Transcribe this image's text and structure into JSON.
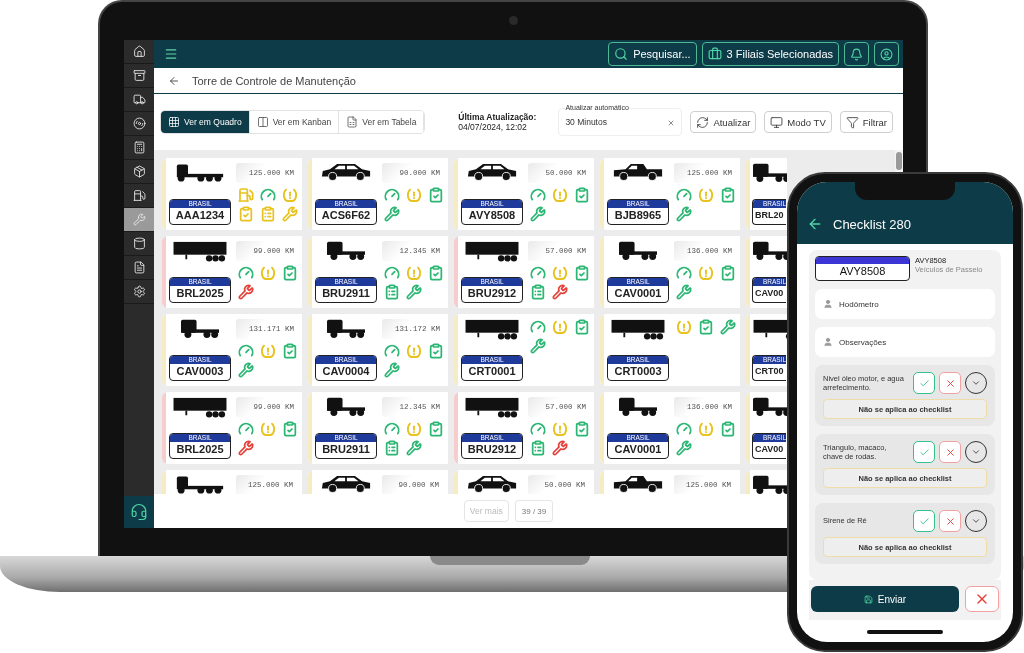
{
  "sidebar": {
    "items": [
      {
        "selected": false
      },
      {
        "selected": false
      },
      {
        "selected": false
      },
      {
        "selected": false
      },
      {
        "selected": false
      },
      {
        "selected": false
      },
      {
        "selected": false
      },
      {
        "selected": true
      },
      {
        "selected": false
      },
      {
        "selected": false
      },
      {
        "selected": false
      }
    ]
  },
  "topbar": {
    "search": "Pesquisar...",
    "branches": "3 Filiais Selecionadas"
  },
  "page": {
    "title": "Torre de Controle de Manutenção"
  },
  "view_tabs": [
    {
      "label": "Ver em Quadro",
      "selected": true
    },
    {
      "label": "Ver em Kanban",
      "selected": false
    },
    {
      "label": "Ver em Tabela",
      "selected": false
    }
  ],
  "last_update": {
    "label": "Última Atualização:",
    "value": "04/07/2024, 12:02"
  },
  "auto_refresh": {
    "label": "Atualizar automático",
    "value": "30 Minutos"
  },
  "buttons": [
    "Atualizar",
    "Modo TV",
    "Filtrar"
  ],
  "vehicles": [
    {
      "kind": "truck",
      "odometer": "125.000 KM",
      "plate_header": "BRASIL",
      "plate": "AAA1234",
      "color": "#f5ecc4",
      "statuses": [
        {
          "kind": "fuel",
          "color": "#e8c21e"
        },
        {
          "kind": "gauge",
          "color": "#2bb673"
        },
        {
          "kind": "tire",
          "color": "#e8c21e"
        },
        {
          "kind": "check",
          "color": "#e8c21e"
        },
        {
          "kind": "list",
          "color": "#e8c21e"
        },
        {
          "kind": "tools",
          "color": "#e8c21e"
        }
      ]
    },
    {
      "kind": "car",
      "odometer": "90.000 KM",
      "plate_header": "BRASIL",
      "plate": "ACS6F62",
      "color": "#f5ecc4",
      "statuses": [
        {
          "kind": "gauge",
          "color": "#2bb673"
        },
        {
          "kind": "tire",
          "color": "#e8c21e"
        },
        {
          "kind": "check",
          "color": "#2bb673"
        },
        {
          "kind": "tools",
          "color": "#2bb673"
        }
      ]
    },
    {
      "kind": "car",
      "odometer": "50.000 KM",
      "plate_header": "BRASIL",
      "plate": "AVY8508",
      "color": "#f5ecc4",
      "statuses": [
        {
          "kind": "gauge",
          "color": "#2bb673"
        },
        {
          "kind": "tire",
          "color": "#e8c21e"
        },
        {
          "kind": "check",
          "color": "#2bb673"
        },
        {
          "kind": "tools",
          "color": "#2bb673"
        }
      ]
    },
    {
      "kind": "pickup",
      "odometer": "125.000 KM",
      "plate_header": "BRASIL",
      "plate": "BJB8965",
      "color": "#f5ecc4",
      "statuses": [
        {
          "kind": "gauge",
          "color": "#2bb673"
        },
        {
          "kind": "tire",
          "color": "#e8c21e"
        },
        {
          "kind": "check",
          "color": "#2bb673"
        },
        {
          "kind": "tools",
          "color": "#2bb673"
        }
      ]
    },
    {
      "kind": "tractor",
      "plate_header": "BRASIL",
      "plate": "BRL20",
      "color": "#f5ecc4"
    },
    {
      "kind": "trailer",
      "odometer": "99.000 KM",
      "plate_header": "BRASIL",
      "plate": "BRL2025",
      "color": "#f6cccc",
      "statuses": [
        {
          "kind": "gauge",
          "color": "#2bb673"
        },
        {
          "kind": "tire",
          "color": "#e8c21e"
        },
        {
          "kind": "check",
          "color": "#2bb673"
        },
        {
          "kind": "tools",
          "color": "#e5413b"
        }
      ]
    },
    {
      "kind": "tractor",
      "odometer": "12.345 KM",
      "plate_header": "BRASIL",
      "plate": "BRU2911",
      "color": "#f5ecc4",
      "statuses": [
        {
          "kind": "gauge",
          "color": "#2bb673"
        },
        {
          "kind": "tire",
          "color": "#e8c21e"
        },
        {
          "kind": "check",
          "color": "#2bb673"
        },
        {
          "kind": "list",
          "color": "#2bb673"
        },
        {
          "kind": "tools",
          "color": "#2bb673"
        }
      ]
    },
    {
      "kind": "trailer",
      "odometer": "57.000 KM",
      "plate_header": "BRASIL",
      "plate": "BRU2912",
      "color": "#f6cccc",
      "statuses": [
        {
          "kind": "gauge",
          "color": "#2bb673"
        },
        {
          "kind": "tire",
          "color": "#e8c21e"
        },
        {
          "kind": "check",
          "color": "#2bb673"
        },
        {
          "kind": "list",
          "color": "#2bb673"
        },
        {
          "kind": "tools",
          "color": "#e5413b"
        }
      ]
    },
    {
      "kind": "tractor",
      "odometer": "136.000 KM",
      "plate_header": "BRASIL",
      "plate": "CAV0001",
      "color": "#f5ecc4",
      "statuses": [
        {
          "kind": "gauge",
          "color": "#2bb673"
        },
        {
          "kind": "tire",
          "color": "#e8c21e"
        },
        {
          "kind": "check",
          "color": "#2bb673"
        },
        {
          "kind": "tools",
          "color": "#2bb673"
        }
      ]
    },
    {
      "kind": "tractor",
      "plate_header": "BRASIL",
      "plate": "CAV00",
      "color": "#f5ecc4"
    },
    {
      "kind": "tractor",
      "odometer": "131.171 KM",
      "plate_header": "BRASIL",
      "plate": "CAV0003",
      "color": "#f5ecc4",
      "statuses": [
        {
          "kind": "gauge",
          "color": "#2bb673"
        },
        {
          "kind": "tire",
          "color": "#e8c21e"
        },
        {
          "kind": "check",
          "color": "#2bb673"
        },
        {
          "kind": "tools",
          "color": "#2bb673"
        }
      ]
    },
    {
      "kind": "tractor",
      "odometer": "131.172 KM",
      "plate_header": "BRASIL",
      "plate": "CAV0004",
      "color": "#f5ecc4",
      "statuses": [
        {
          "kind": "gauge",
          "color": "#2bb673"
        },
        {
          "kind": "tire",
          "color": "#e8c21e"
        },
        {
          "kind": "check",
          "color": "#2bb673"
        },
        {
          "kind": "tools",
          "color": "#2bb673"
        }
      ]
    },
    {
      "kind": "trailer",
      "plate_header": "BRASIL",
      "plate": "CRT0001",
      "color": "#f5ecc4",
      "statuses": [
        {
          "kind": "gauge",
          "color": "#2bb673"
        },
        {
          "kind": "tire",
          "color": "#e8c21e"
        },
        {
          "kind": "check",
          "color": "#2bb673"
        },
        {
          "kind": "tools",
          "color": "#2bb673"
        }
      ]
    },
    {
      "kind": "trailer",
      "plate_header": "BRASIL",
      "plate": "CRT0003",
      "color": "#f5ecc4",
      "statuses": [
        {
          "kind": "tire",
          "color": "#e8c21e"
        },
        {
          "kind": "check",
          "color": "#2bb673"
        },
        {
          "kind": "tools",
          "color": "#2bb673"
        }
      ]
    },
    {
      "kind": "trailer",
      "plate_header": "BRASIL",
      "plate": "CRT00",
      "color": "#f5ecc4"
    },
    {
      "kind": "trailer",
      "odometer": "99.000 KM",
      "plate_header": "BRASIL",
      "plate": "BRL2025",
      "color": "#f6cccc",
      "statuses": [
        {
          "kind": "gauge",
          "color": "#2bb673"
        },
        {
          "kind": "tire",
          "color": "#e8c21e"
        },
        {
          "kind": "check",
          "color": "#2bb673"
        },
        {
          "kind": "tools",
          "color": "#e5413b"
        }
      ]
    },
    {
      "kind": "tractor",
      "odometer": "12.345 KM",
      "plate_header": "BRASIL",
      "plate": "BRU2911",
      "color": "#f5ecc4",
      "statuses": [
        {
          "kind": "gauge",
          "color": "#2bb673"
        },
        {
          "kind": "tire",
          "color": "#e8c21e"
        },
        {
          "kind": "check",
          "color": "#2bb673"
        },
        {
          "kind": "list",
          "color": "#2bb673"
        },
        {
          "kind": "tools",
          "color": "#2bb673"
        }
      ]
    },
    {
      "kind": "trailer",
      "odometer": "57.000 KM",
      "plate_header": "BRASIL",
      "plate": "BRU2912",
      "color": "#f6cccc",
      "statuses": [
        {
          "kind": "gauge",
          "color": "#2bb673"
        },
        {
          "kind": "tire",
          "color": "#e8c21e"
        },
        {
          "kind": "check",
          "color": "#2bb673"
        },
        {
          "kind": "list",
          "color": "#2bb673"
        },
        {
          "kind": "tools",
          "color": "#e5413b"
        }
      ]
    },
    {
      "kind": "tractor",
      "odometer": "136.000 KM",
      "plate_header": "BRASIL",
      "plate": "CAV0001",
      "color": "#f5ecc4",
      "statuses": [
        {
          "kind": "gauge",
          "color": "#2bb673"
        },
        {
          "kind": "tire",
          "color": "#e8c21e"
        },
        {
          "kind": "check",
          "color": "#2bb673"
        },
        {
          "kind": "tools",
          "color": "#2bb673"
        }
      ]
    },
    {
      "kind": "tractor",
      "plate_header": "BRASIL",
      "plate": "CAV00",
      "color": "#f5ecc4"
    },
    {
      "kind": "truck",
      "odometer": "125.000 KM",
      "color": "#f5ecc4"
    },
    {
      "kind": "car",
      "odometer": "90.000 KM",
      "color": "#f5ecc4"
    },
    {
      "kind": "car",
      "odometer": "50.000 KM",
      "color": "#f5ecc4"
    },
    {
      "kind": "pickup",
      "odometer": "125.000 KM",
      "color": "#f5ecc4"
    },
    {
      "kind": "tractor",
      "color": "#f5ecc4"
    }
  ],
  "footer": {
    "more": "Ver mais",
    "more_disabled": true,
    "count": "39 / 39"
  },
  "phone": {
    "title": "Checklist 280",
    "plate": "AVY8508",
    "plate_name": "AVY8508",
    "category": "Veículos de Passeio",
    "fields": [
      {
        "placeholder": "Hodômetro"
      },
      {
        "placeholder": "Observações"
      }
    ],
    "checklist": [
      {
        "label": "Nivel óleo motor, e agua arrefecimento.",
        "not_applicable": "Não se aplica ao checklist"
      },
      {
        "label": "Triangulo, macaco, chave de rodas.",
        "not_applicable": "Não se aplica ao checklist"
      },
      {
        "label": "Sirene de Ré",
        "not_applicable": "Não se aplica ao checklist"
      }
    ],
    "submit": "Enviar"
  }
}
